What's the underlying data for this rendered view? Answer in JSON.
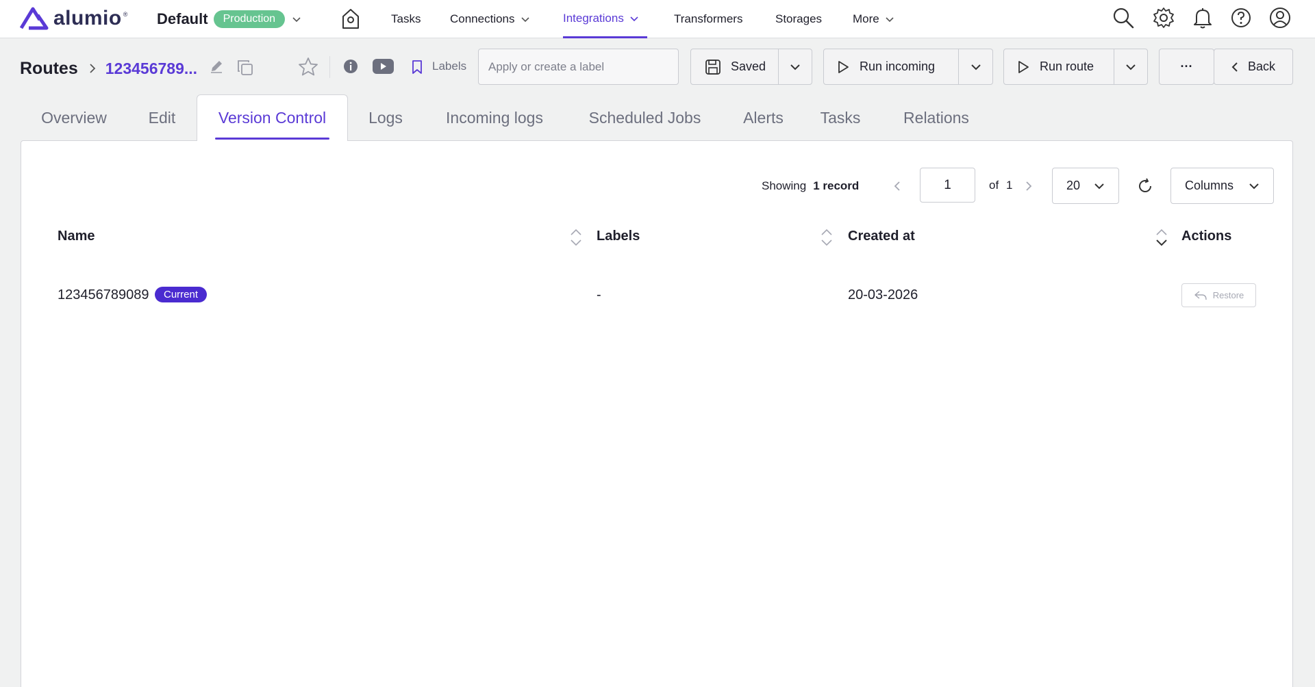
{
  "app": {
    "logo_text": "alumio",
    "logo_tm": "®",
    "environment": "Default",
    "environment_badge": "Production"
  },
  "nav": {
    "tasks": "Tasks",
    "connections": "Connections",
    "integrations": "Integrations",
    "transformers": "Transformers",
    "storages": "Storages",
    "more": "More",
    "active": "Integrations"
  },
  "breadcrumb": {
    "root": "Routes",
    "current": "123456789..."
  },
  "toolbar": {
    "labels": "Labels",
    "label_placeholder": "Apply or create a label",
    "saved": "Saved",
    "run_incoming": "Run incoming",
    "run_route": "Run route",
    "more": "···",
    "back": "Back"
  },
  "tabs": [
    {
      "label": "Overview"
    },
    {
      "label": "Edit"
    },
    {
      "label": "Version Control",
      "active": true
    },
    {
      "label": "Logs"
    },
    {
      "label": "Incoming logs"
    },
    {
      "label": "Scheduled Jobs"
    },
    {
      "label": "Alerts"
    },
    {
      "label": "Tasks"
    },
    {
      "label": "Relations"
    }
  ],
  "pagination": {
    "showing": "Showing",
    "count": "1 record",
    "page": "1",
    "of": "of",
    "total_pages": "1",
    "page_size": "20",
    "columns": "Columns"
  },
  "table": {
    "headers": {
      "name": "Name",
      "labels": "Labels",
      "created_at": "Created at",
      "actions": "Actions"
    },
    "rows": [
      {
        "name": "123456789089",
        "badge": "Current",
        "labels": "-",
        "created_at": "20-03-2026",
        "action": "Restore"
      }
    ]
  },
  "colors": {
    "accent": "#5a3ad6",
    "production_badge": "#66c490",
    "current_badge": "#4a2bd0"
  }
}
